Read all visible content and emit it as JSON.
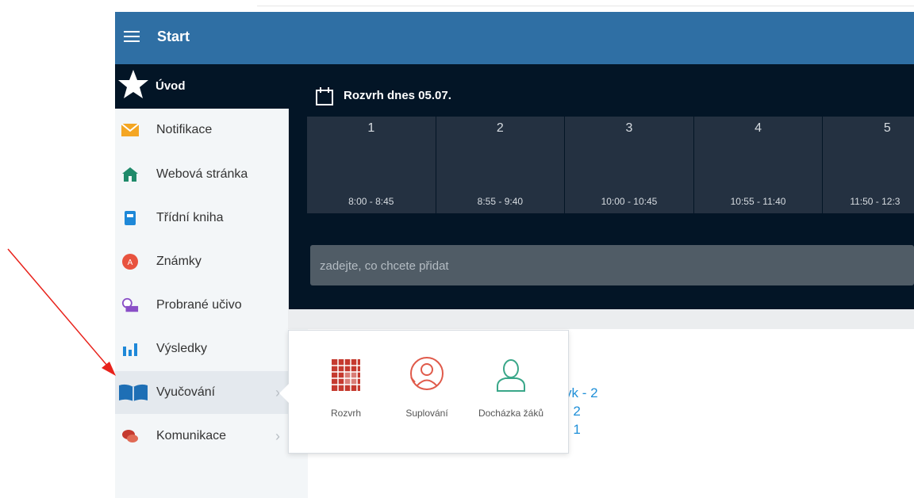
{
  "header": {
    "title": "Start"
  },
  "uvod": {
    "label": "Úvod"
  },
  "sidebar": {
    "items": [
      {
        "label": "Notifikace",
        "icon": "envelope-icon"
      },
      {
        "label": "Webová stránka",
        "icon": "home-icon"
      },
      {
        "label": "Třídní kniha",
        "icon": "book-icon"
      },
      {
        "label": "Známky",
        "icon": "grades-icon"
      },
      {
        "label": "Probrané učivo",
        "icon": "curriculum-icon"
      },
      {
        "label": "Výsledky",
        "icon": "bar-chart-icon"
      },
      {
        "label": "Vyučování",
        "icon": "open-book-icon"
      },
      {
        "label": "Komunikace",
        "icon": "chat-icon"
      }
    ]
  },
  "schedule": {
    "title": "Rozvrh dnes 05.07.",
    "periods": [
      {
        "num": "1",
        "time": "8:00 - 8:45"
      },
      {
        "num": "2",
        "time": "8:55 - 9:40"
      },
      {
        "num": "3",
        "time": "10:00 - 10:45"
      },
      {
        "num": "4",
        "time": "10:55 - 11:40"
      },
      {
        "num": "5",
        "time": "11:50 - 12:3"
      }
    ]
  },
  "add_input": {
    "placeholder": "zadejte, co chcete přidat"
  },
  "popup": {
    "items": [
      {
        "label": "Rozvrh",
        "icon": "calendar-grid-icon"
      },
      {
        "label": "Suplování",
        "icon": "substitute-person-icon"
      },
      {
        "label": "Docházka žáků",
        "icon": "person-icon"
      }
    ]
  },
  "behind_text": {
    "line1": "yk - 2",
    "line2": "- 2",
    "line3": "- 1"
  },
  "colors": {
    "topbar": "#2f6fa4",
    "dark": "#031526",
    "period": "#243141",
    "link": "#1e8fd8",
    "popup_red": "#c53a2f",
    "popup_teal": "#3aa789"
  }
}
